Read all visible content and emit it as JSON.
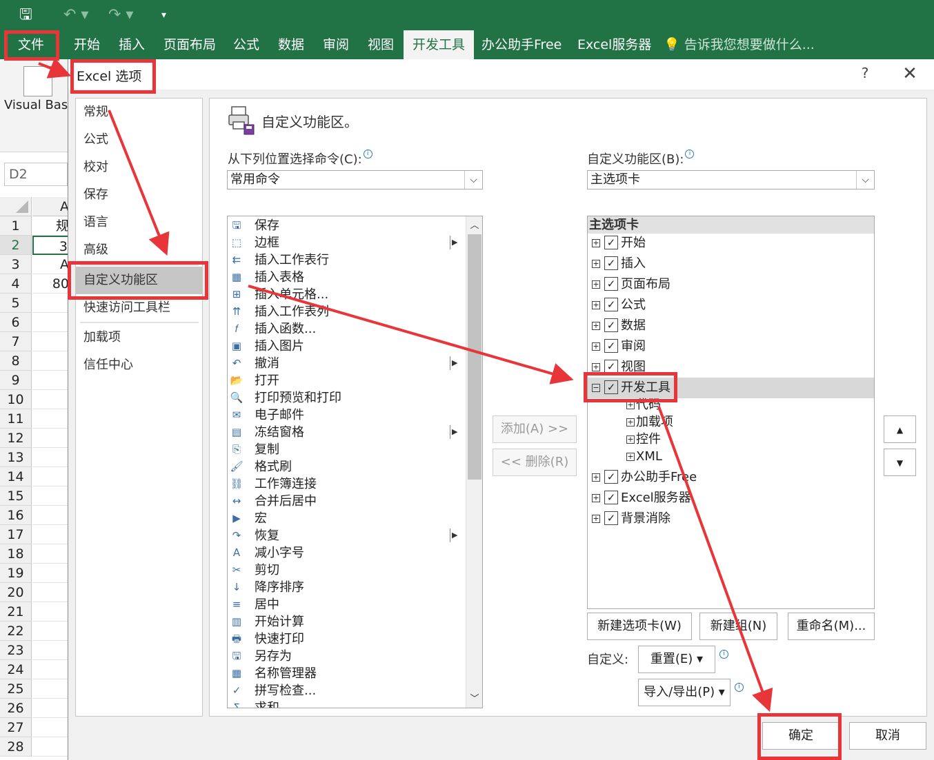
{
  "excel": {
    "tabs": [
      "文件",
      "开始",
      "插入",
      "页面布局",
      "公式",
      "数据",
      "审阅",
      "视图",
      "开发工具",
      "办公助手Free",
      "Excel服务器"
    ],
    "tell_me": "告诉我您想要做什么...",
    "visual_basic": "Visual Basic",
    "name_box": "D2",
    "col_a_header": "A",
    "rows": [
      "1",
      "2",
      "3",
      "4",
      "5",
      "6",
      "7",
      "8",
      "9",
      "10",
      "11",
      "12",
      "13",
      "14",
      "15",
      "16",
      "17",
      "18",
      "19",
      "20",
      "21",
      "22",
      "23",
      "24",
      "25",
      "26",
      "27",
      "28"
    ],
    "col_a_values": [
      "规",
      "3",
      "A",
      "80"
    ]
  },
  "dialog": {
    "title": "Excel 选项",
    "help": "?",
    "close": "✕",
    "nav": [
      "常规",
      "公式",
      "校对",
      "保存",
      "语言",
      "高级",
      "自定义功能区",
      "快速访问工具栏",
      "加载项",
      "信任中心"
    ],
    "heading": "自定义功能区。",
    "choose_label": "从下列位置选择命令(C):",
    "choose_value": "常用命令",
    "customize_label": "自定义功能区(B):",
    "customize_value": "主选项卡",
    "commands": [
      "保存",
      "边框",
      "插入工作表行",
      "插入表格",
      "插入单元格...",
      "插入工作表列",
      "插入函数...",
      "插入图片",
      "撤消",
      "打开",
      "打印预览和打印",
      "电子邮件",
      "冻结窗格",
      "复制",
      "格式刷",
      "工作簿连接",
      "合并后居中",
      "宏",
      "恢复",
      "减小字号",
      "剪切",
      "降序排序",
      "居中",
      "开始计算",
      "快速打印",
      "另存为",
      "名称管理器",
      "拼写检查...",
      "求和"
    ],
    "add_button": "添加(A) >>",
    "remove_button": "<< 删除(R)",
    "tree_header": "主选项卡",
    "tree": [
      "开始",
      "插入",
      "页面布局",
      "公式",
      "数据",
      "审阅",
      "视图",
      "开发工具"
    ],
    "tree_children": [
      "代码",
      "加载项",
      "控件",
      "XML"
    ],
    "tree_after": [
      "办公助手Free",
      "Excel服务器",
      "背景消除"
    ],
    "new_tab_button": "新建选项卡(W)",
    "new_group_button": "新建组(N)",
    "rename_button": "重命名(M)...",
    "customize_text": "自定义:",
    "reset_button": "重置(E) ▾",
    "import_export_button": "导入/导出(P) ▾",
    "ok_button": "确定",
    "cancel_button": "取消"
  },
  "colors": {
    "excel_green": "#217346",
    "annotation_red": "#e8353a"
  }
}
